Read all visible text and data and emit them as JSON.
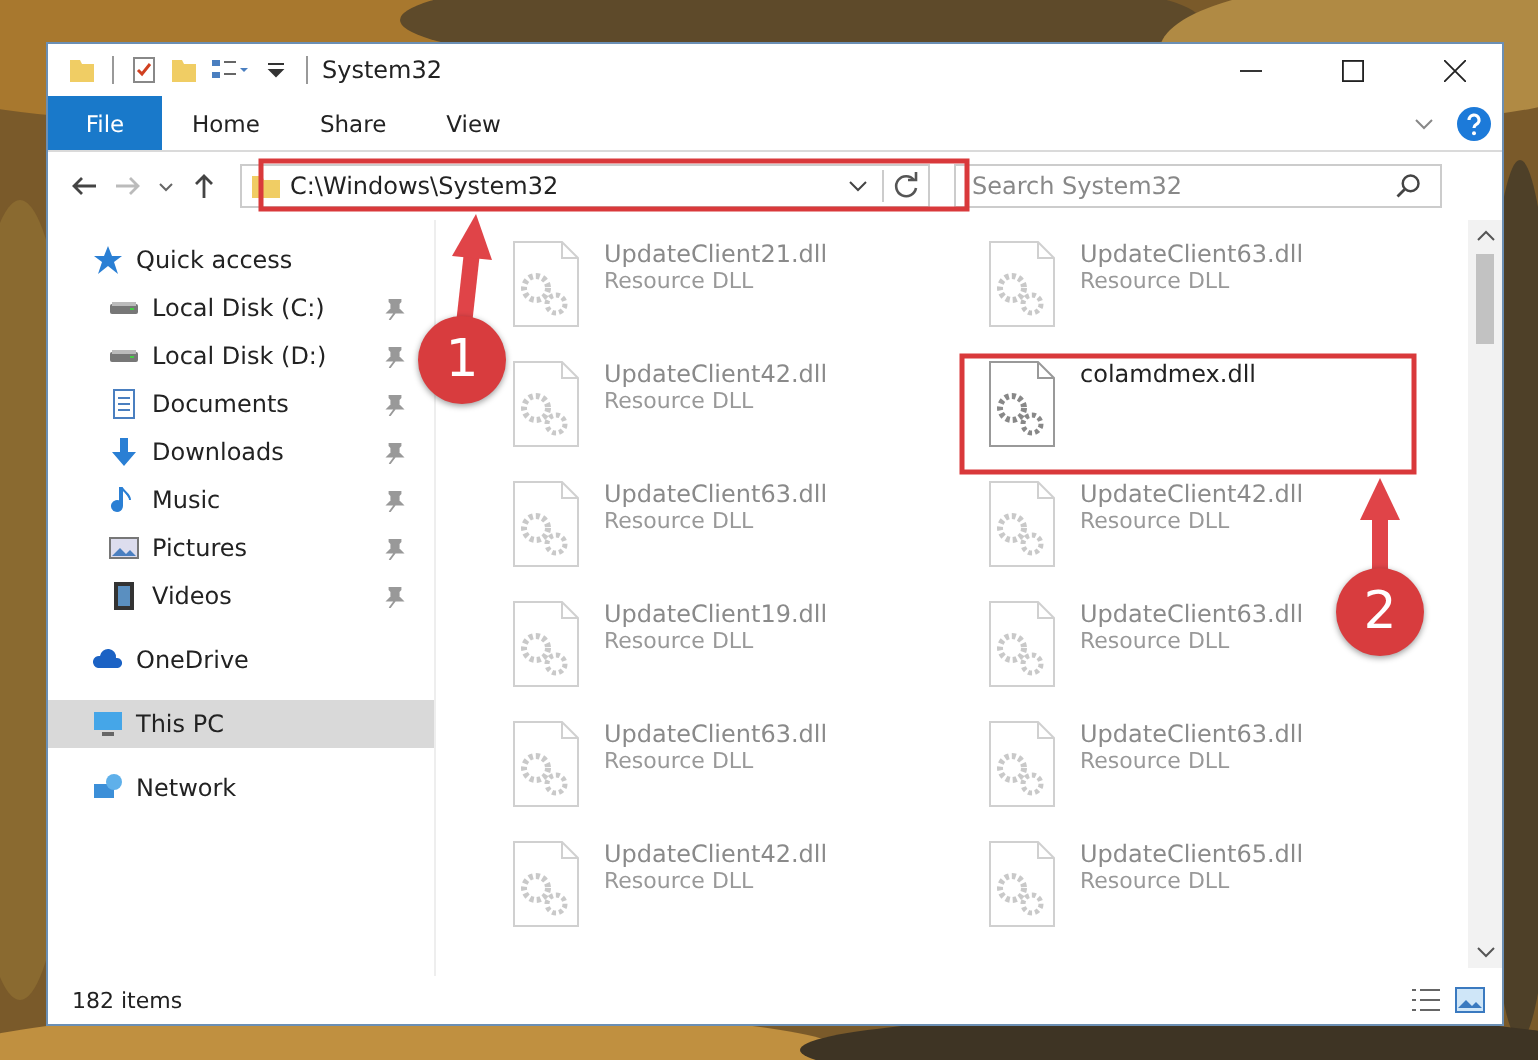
{
  "window": {
    "title": "System32"
  },
  "ribbon_tabs": [
    {
      "label": "File",
      "selected": true
    },
    {
      "label": "Home",
      "selected": false
    },
    {
      "label": "Share",
      "selected": false
    },
    {
      "label": "View",
      "selected": false
    }
  ],
  "address": {
    "path": "C:\\Windows\\System32"
  },
  "search": {
    "placeholder": "Search System32"
  },
  "sidebar": {
    "items": [
      {
        "label": "Quick access",
        "kind": "star",
        "selected": false,
        "children": [
          {
            "label": "Local Disk (C:)",
            "kind": "drive",
            "pinned": true,
            "selected": false
          },
          {
            "label": "Local Disk (D:)",
            "kind": "drive",
            "pinned": true,
            "selected": false
          },
          {
            "label": "Documents",
            "kind": "documents",
            "pinned": true,
            "selected": false
          },
          {
            "label": "Downloads",
            "kind": "downloads",
            "pinned": true,
            "selected": false
          },
          {
            "label": "Music",
            "kind": "music",
            "pinned": true,
            "selected": false
          },
          {
            "label": "Pictures",
            "kind": "pictures",
            "pinned": true,
            "selected": false
          },
          {
            "label": "Videos",
            "kind": "videos",
            "pinned": true,
            "selected": false
          }
        ]
      },
      {
        "label": "OneDrive",
        "kind": "cloud",
        "selected": false
      },
      {
        "label": "This PC",
        "kind": "pc",
        "selected": true
      },
      {
        "label": "Network",
        "kind": "network",
        "selected": false
      }
    ]
  },
  "files": [
    {
      "name": "UpdateClient21.dll",
      "type": "Resource DLL",
      "faded": true
    },
    {
      "name": "UpdateClient63.dll",
      "type": "Resource DLL",
      "faded": true
    },
    {
      "name": "UpdateClient42.dll",
      "type": "Resource DLL",
      "faded": true
    },
    {
      "name": "colamdmex.dll",
      "faded": false
    },
    {
      "name": "UpdateClient63.dll",
      "type": "Resource DLL",
      "faded": true
    },
    {
      "name": "UpdateClient42.dll",
      "type": "Resource DLL",
      "faded": true
    },
    {
      "name": "UpdateClient19.dll",
      "type": "Resource DLL",
      "faded": true
    },
    {
      "name": "UpdateClient63.dll",
      "type": "Resource DLL",
      "faded": true
    },
    {
      "name": "UpdateClient63.dll",
      "type": "Resource DLL",
      "faded": true
    },
    {
      "name": "UpdateClient63.dll",
      "type": "Resource DLL",
      "faded": true
    },
    {
      "name": "UpdateClient42.dll",
      "type": "Resource DLL",
      "faded": true
    },
    {
      "name": "UpdateClient65.dll",
      "type": "Resource DLL",
      "faded": true
    }
  ],
  "status_bar": {
    "count": "182 items"
  },
  "callouts": [
    {
      "number": "1"
    },
    {
      "number": "2"
    }
  ]
}
